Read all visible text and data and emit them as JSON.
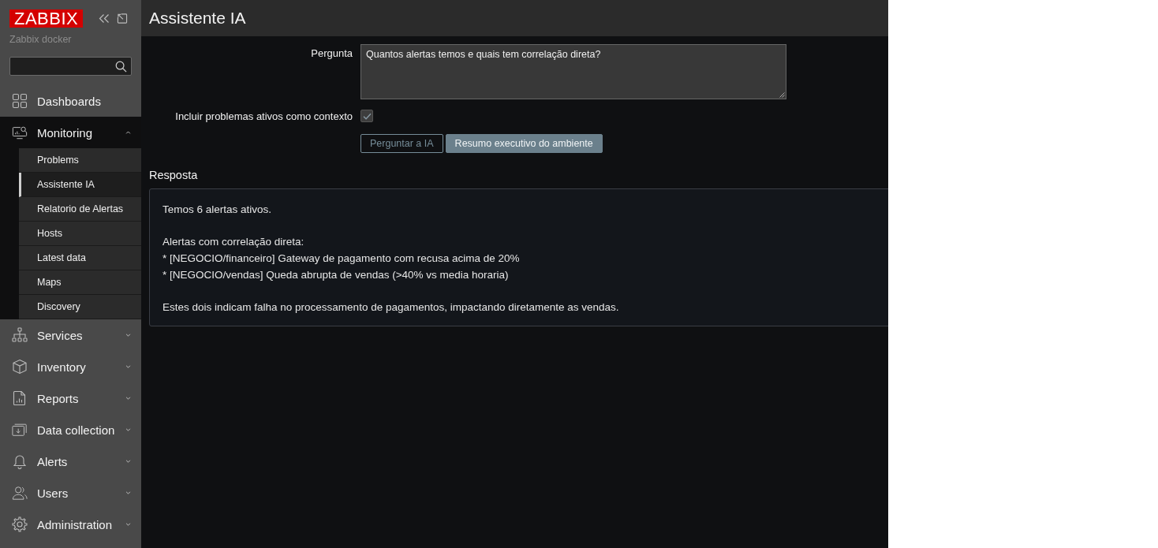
{
  "sidebar": {
    "logo": "ZABBIX",
    "server_name": "Zabbix docker",
    "menu": [
      {
        "label": "Dashboards",
        "kind": "link"
      },
      {
        "label": "Monitoring",
        "kind": "group",
        "expanded": true,
        "children": [
          {
            "label": "Problems",
            "selected": false
          },
          {
            "label": "Assistente IA",
            "selected": true
          },
          {
            "label": "Relatorio de Alertas",
            "selected": false
          },
          {
            "label": "Hosts",
            "selected": false
          },
          {
            "label": "Latest data",
            "selected": false
          },
          {
            "label": "Maps",
            "selected": false
          },
          {
            "label": "Discovery",
            "selected": false
          }
        ]
      },
      {
        "label": "Services",
        "kind": "group",
        "expanded": false
      },
      {
        "label": "Inventory",
        "kind": "group",
        "expanded": false
      },
      {
        "label": "Reports",
        "kind": "group",
        "expanded": false
      },
      {
        "label": "Data collection",
        "kind": "group",
        "expanded": false
      },
      {
        "label": "Alerts",
        "kind": "group",
        "expanded": false
      },
      {
        "label": "Users",
        "kind": "group",
        "expanded": false
      },
      {
        "label": "Administration",
        "kind": "group",
        "expanded": false
      }
    ]
  },
  "page": {
    "title": "Assistente IA",
    "form": {
      "question": {
        "label": "Pergunta",
        "value": "Quantos alertas temos e quais tem correlação direta?"
      },
      "context": {
        "label": "Incluir problemas ativos como contexto",
        "checked": true
      },
      "buttons": [
        {
          "label": "Perguntar a IA",
          "kind": "secondary"
        },
        {
          "label": "Resumo executivo do ambiente",
          "kind": "primary"
        }
      ]
    },
    "response": {
      "heading": "Resposta",
      "paragraphs": [
        [
          "Temos 6 alertas ativos."
        ],
        [
          "Alertas com correlação direta:",
          "* [NEGOCIO/financeiro] Gateway de pagamento com recusa acima de 20%",
          "* [NEGOCIO/vendas] Queda abrupta de vendas (>40% vs media horaria)"
        ],
        [
          "Estes dois indicam falha no processamento de pagamentos, impactando diretamente as vendas."
        ]
      ]
    }
  }
}
